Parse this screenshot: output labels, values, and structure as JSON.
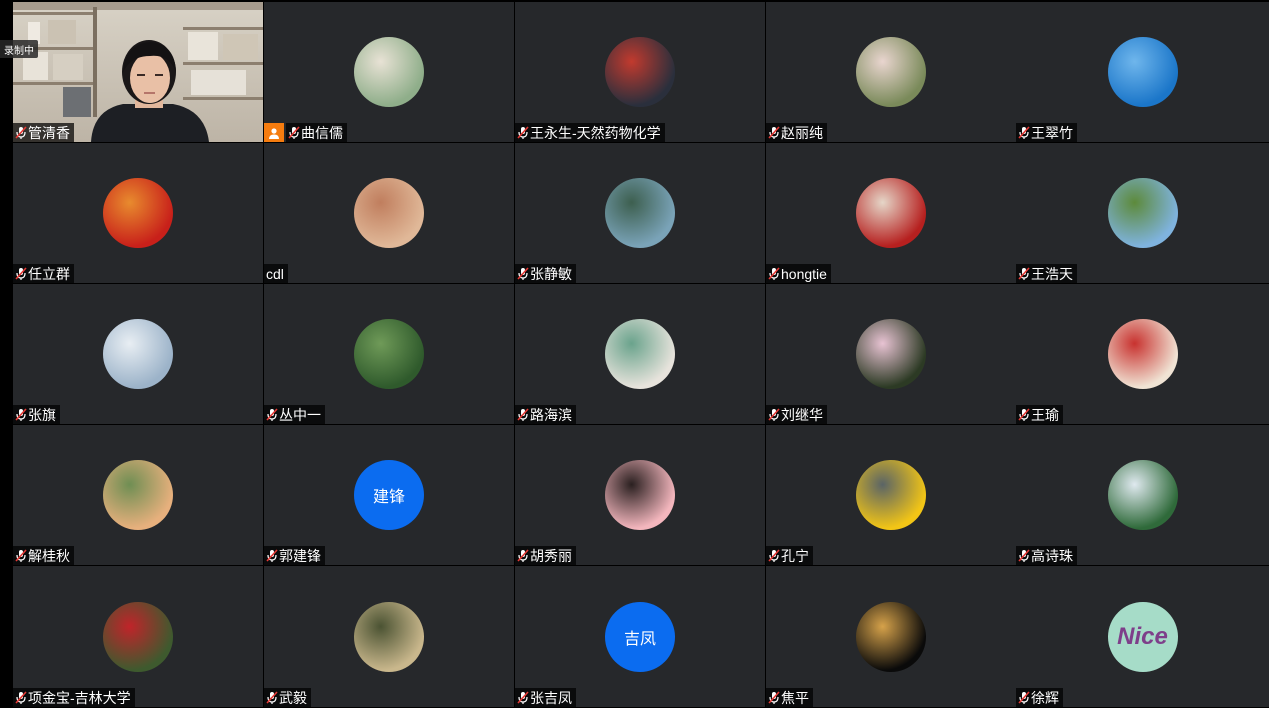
{
  "recording_label": "录制中",
  "host_name": "管清香",
  "participants": [
    {
      "name": "曲信儒",
      "host_badge": true,
      "avatar_color": "#8fae8a",
      "avatar_color2": "#e8e2d5"
    },
    {
      "name": "王永生-天然药物化学",
      "avatar_color": "#2a2f3c",
      "avatar_color2": "#c23a2e"
    },
    {
      "name": "赵丽纯",
      "avatar_color": "#7a8a5a",
      "avatar_color2": "#e9d5cf"
    },
    {
      "name": "王翠竹",
      "avatar_color": "#1b76c9",
      "avatar_color2": "#6fb6ec"
    },
    {
      "name": "任立群",
      "avatar_color": "#c8201a",
      "avatar_color2": "#e88b2e"
    },
    {
      "name": "cdl",
      "no_mic": true,
      "avatar_color": "#e0b898",
      "avatar_color2": "#c07e5e"
    },
    {
      "name": "张静敏",
      "avatar_color": "#7aa3b8",
      "avatar_color2": "#3d5f4f"
    },
    {
      "name": "hongtie",
      "avatar_color": "#b6201f",
      "avatar_color2": "#e5d6c8"
    },
    {
      "name": "王浩天",
      "avatar_color": "#7fb3de",
      "avatar_color2": "#5d8a3b"
    },
    {
      "name": "张旗",
      "avatar_color": "#9cb3c9",
      "avatar_color2": "#e8eef3"
    },
    {
      "name": "丛中一",
      "avatar_color": "#2f5a2c",
      "avatar_color2": "#6f9a58"
    },
    {
      "name": "路海滨",
      "avatar_color": "#e7e3dc",
      "avatar_color2": "#6aa38c"
    },
    {
      "name": "刘继华",
      "avatar_color": "#2c3a24",
      "avatar_color2": "#e8c3d3"
    },
    {
      "name": "王瑜",
      "avatar_color": "#f0e3d4",
      "avatar_color2": "#c8322f"
    },
    {
      "name": "解桂秋",
      "avatar_color": "#e7b07d",
      "avatar_color2": "#6f8e53"
    },
    {
      "name": "郭建锋",
      "avatar_text": "建锋",
      "avatar_color": "#0b6cf0"
    },
    {
      "name": "胡秀丽",
      "avatar_color": "#f3b6bd",
      "avatar_color2": "#2a2020"
    },
    {
      "name": "孔宁",
      "avatar_color": "#f2c516",
      "avatar_color2": "#5a6466"
    },
    {
      "name": "高诗珠",
      "avatar_color": "#2f6a3a",
      "avatar_color2": "#dfe9ef"
    },
    {
      "name": "项金宝-吉林大学",
      "avatar_color": "#3e5a2e",
      "avatar_color2": "#c0242a"
    },
    {
      "name": "武毅",
      "avatar_color": "#c9b78c",
      "avatar_color2": "#4b5333"
    },
    {
      "name": "张吉凤",
      "avatar_text": "吉凤",
      "avatar_color": "#0b6cf0"
    },
    {
      "name": "焦平",
      "avatar_color": "#0a0a0a",
      "avatar_color2": "#d6a24a"
    },
    {
      "name": "徐辉",
      "avatar_color": "#a6dcc8",
      "avatar_color2": "#7e3f8a",
      "avatar_label": "Nice"
    }
  ]
}
